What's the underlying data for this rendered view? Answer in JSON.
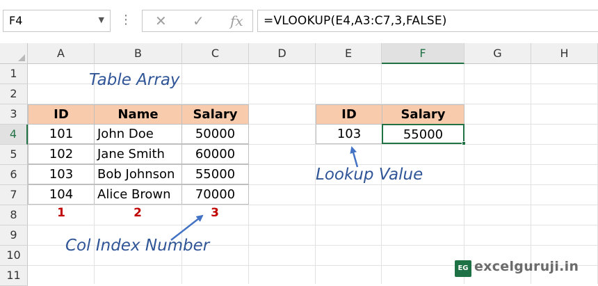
{
  "formula_bar": {
    "name_box": "F4",
    "cancel_icon": "✕",
    "enter_icon": "✓",
    "fx_label": "fx",
    "formula": "=VLOOKUP(E4,A3:C7,3,FALSE)"
  },
  "columns": [
    "A",
    "B",
    "C",
    "D",
    "E",
    "F",
    "G",
    "H"
  ],
  "rows": [
    "1",
    "2",
    "3",
    "4",
    "5",
    "6",
    "7",
    "8",
    "9",
    "10",
    "11"
  ],
  "active_cell": {
    "column": "F",
    "row": "4"
  },
  "table_array": {
    "headers": [
      "ID",
      "Name",
      "Salary"
    ],
    "rows": [
      [
        "101",
        "John Doe",
        "50000"
      ],
      [
        "102",
        "Jane Smith",
        "60000"
      ],
      [
        "103",
        "Bob Johnson",
        "55000"
      ],
      [
        "104",
        "Alice Brown",
        "70000"
      ]
    ]
  },
  "lookup_table": {
    "headers": [
      "ID",
      "Salary"
    ],
    "values": [
      "103",
      "55000"
    ]
  },
  "col_index_numbers": [
    "1",
    "2",
    "3"
  ],
  "annotations": {
    "table_array": "Table Array",
    "lookup_value": "Lookup Value",
    "col_index_number": "Col Index Number"
  },
  "watermark": {
    "logo": "EG",
    "site": "excelguruji.in"
  },
  "colors": {
    "header_fill": "#f8cbad",
    "annotation": "#2f5597",
    "index_number": "#c00000",
    "selection": "#217346"
  }
}
